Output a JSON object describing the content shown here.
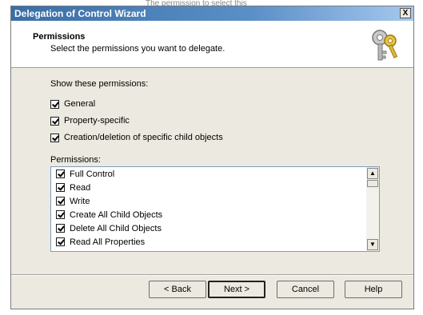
{
  "overlay_text": "The permission to select this",
  "window": {
    "title": "Delegation of Control Wizard",
    "close_label": "X"
  },
  "header": {
    "title": "Permissions",
    "subtitle": "Select the permissions you want to delegate."
  },
  "show_section": {
    "label": "Show these permissions:",
    "options": [
      {
        "label": "General",
        "checked": true
      },
      {
        "label": "Property-specific",
        "checked": true
      },
      {
        "label": "Creation/deletion of specific child objects",
        "checked": true
      }
    ]
  },
  "permissions": {
    "label": "Permissions:",
    "items": [
      {
        "label": "Full Control",
        "checked": true
      },
      {
        "label": "Read",
        "checked": true
      },
      {
        "label": "Write",
        "checked": true
      },
      {
        "label": "Create All Child Objects",
        "checked": true
      },
      {
        "label": "Delete All Child Objects",
        "checked": true
      },
      {
        "label": "Read All Properties",
        "checked": true
      }
    ]
  },
  "buttons": {
    "back": "< Back",
    "next": "Next >",
    "cancel": "Cancel",
    "help": "Help"
  },
  "icons": {
    "header": "keys-icon",
    "scroll_up": "scroll-up-arrow-icon",
    "scroll_down": "scroll-down-arrow-icon"
  },
  "colors": {
    "titlebar": "#3a6ea5",
    "dialog_bg": "#ece9e0"
  }
}
